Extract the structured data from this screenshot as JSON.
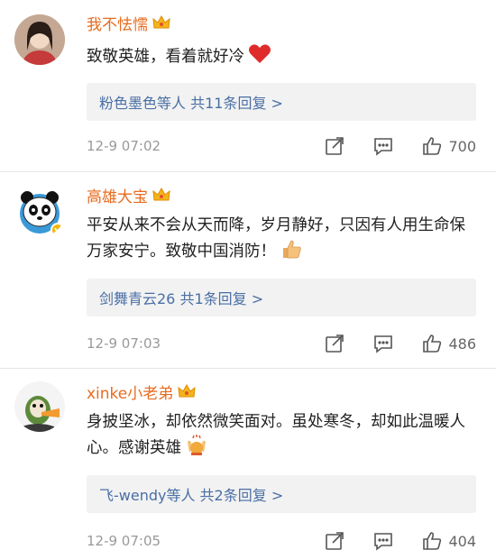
{
  "comments": [
    {
      "username": "我不怯懦",
      "text": "致敬英雄，看着就好冷",
      "emoji": "red-heart",
      "replies": "粉色墨色等人  共11条回复 >",
      "time": "12-9 07:02",
      "likes": "700"
    },
    {
      "username": "高雄大宝",
      "text": "平安从来不会从天而降，岁月静好，只因有人用生命保万家安宁。致敬中国消防！",
      "emoji": "thumbs-up",
      "replies": "剑舞青云26  共1条回复 >",
      "time": "12-9 07:03",
      "likes": "486"
    },
    {
      "username": "xinke小老弟",
      "text": "身披坚冰，却依然微笑面对。虽处寒冬，却如此温暖人心。感谢英雄",
      "emoji": "clapping-hands",
      "replies": "飞-wendy等人  共2条回复 >",
      "time": "12-9 07:05",
      "likes": "404"
    }
  ],
  "colors": {
    "username": "#e86b1f",
    "reply_link": "#4a6fa5",
    "reply_bg": "#f2f2f2",
    "meta_gray": "#999999"
  }
}
